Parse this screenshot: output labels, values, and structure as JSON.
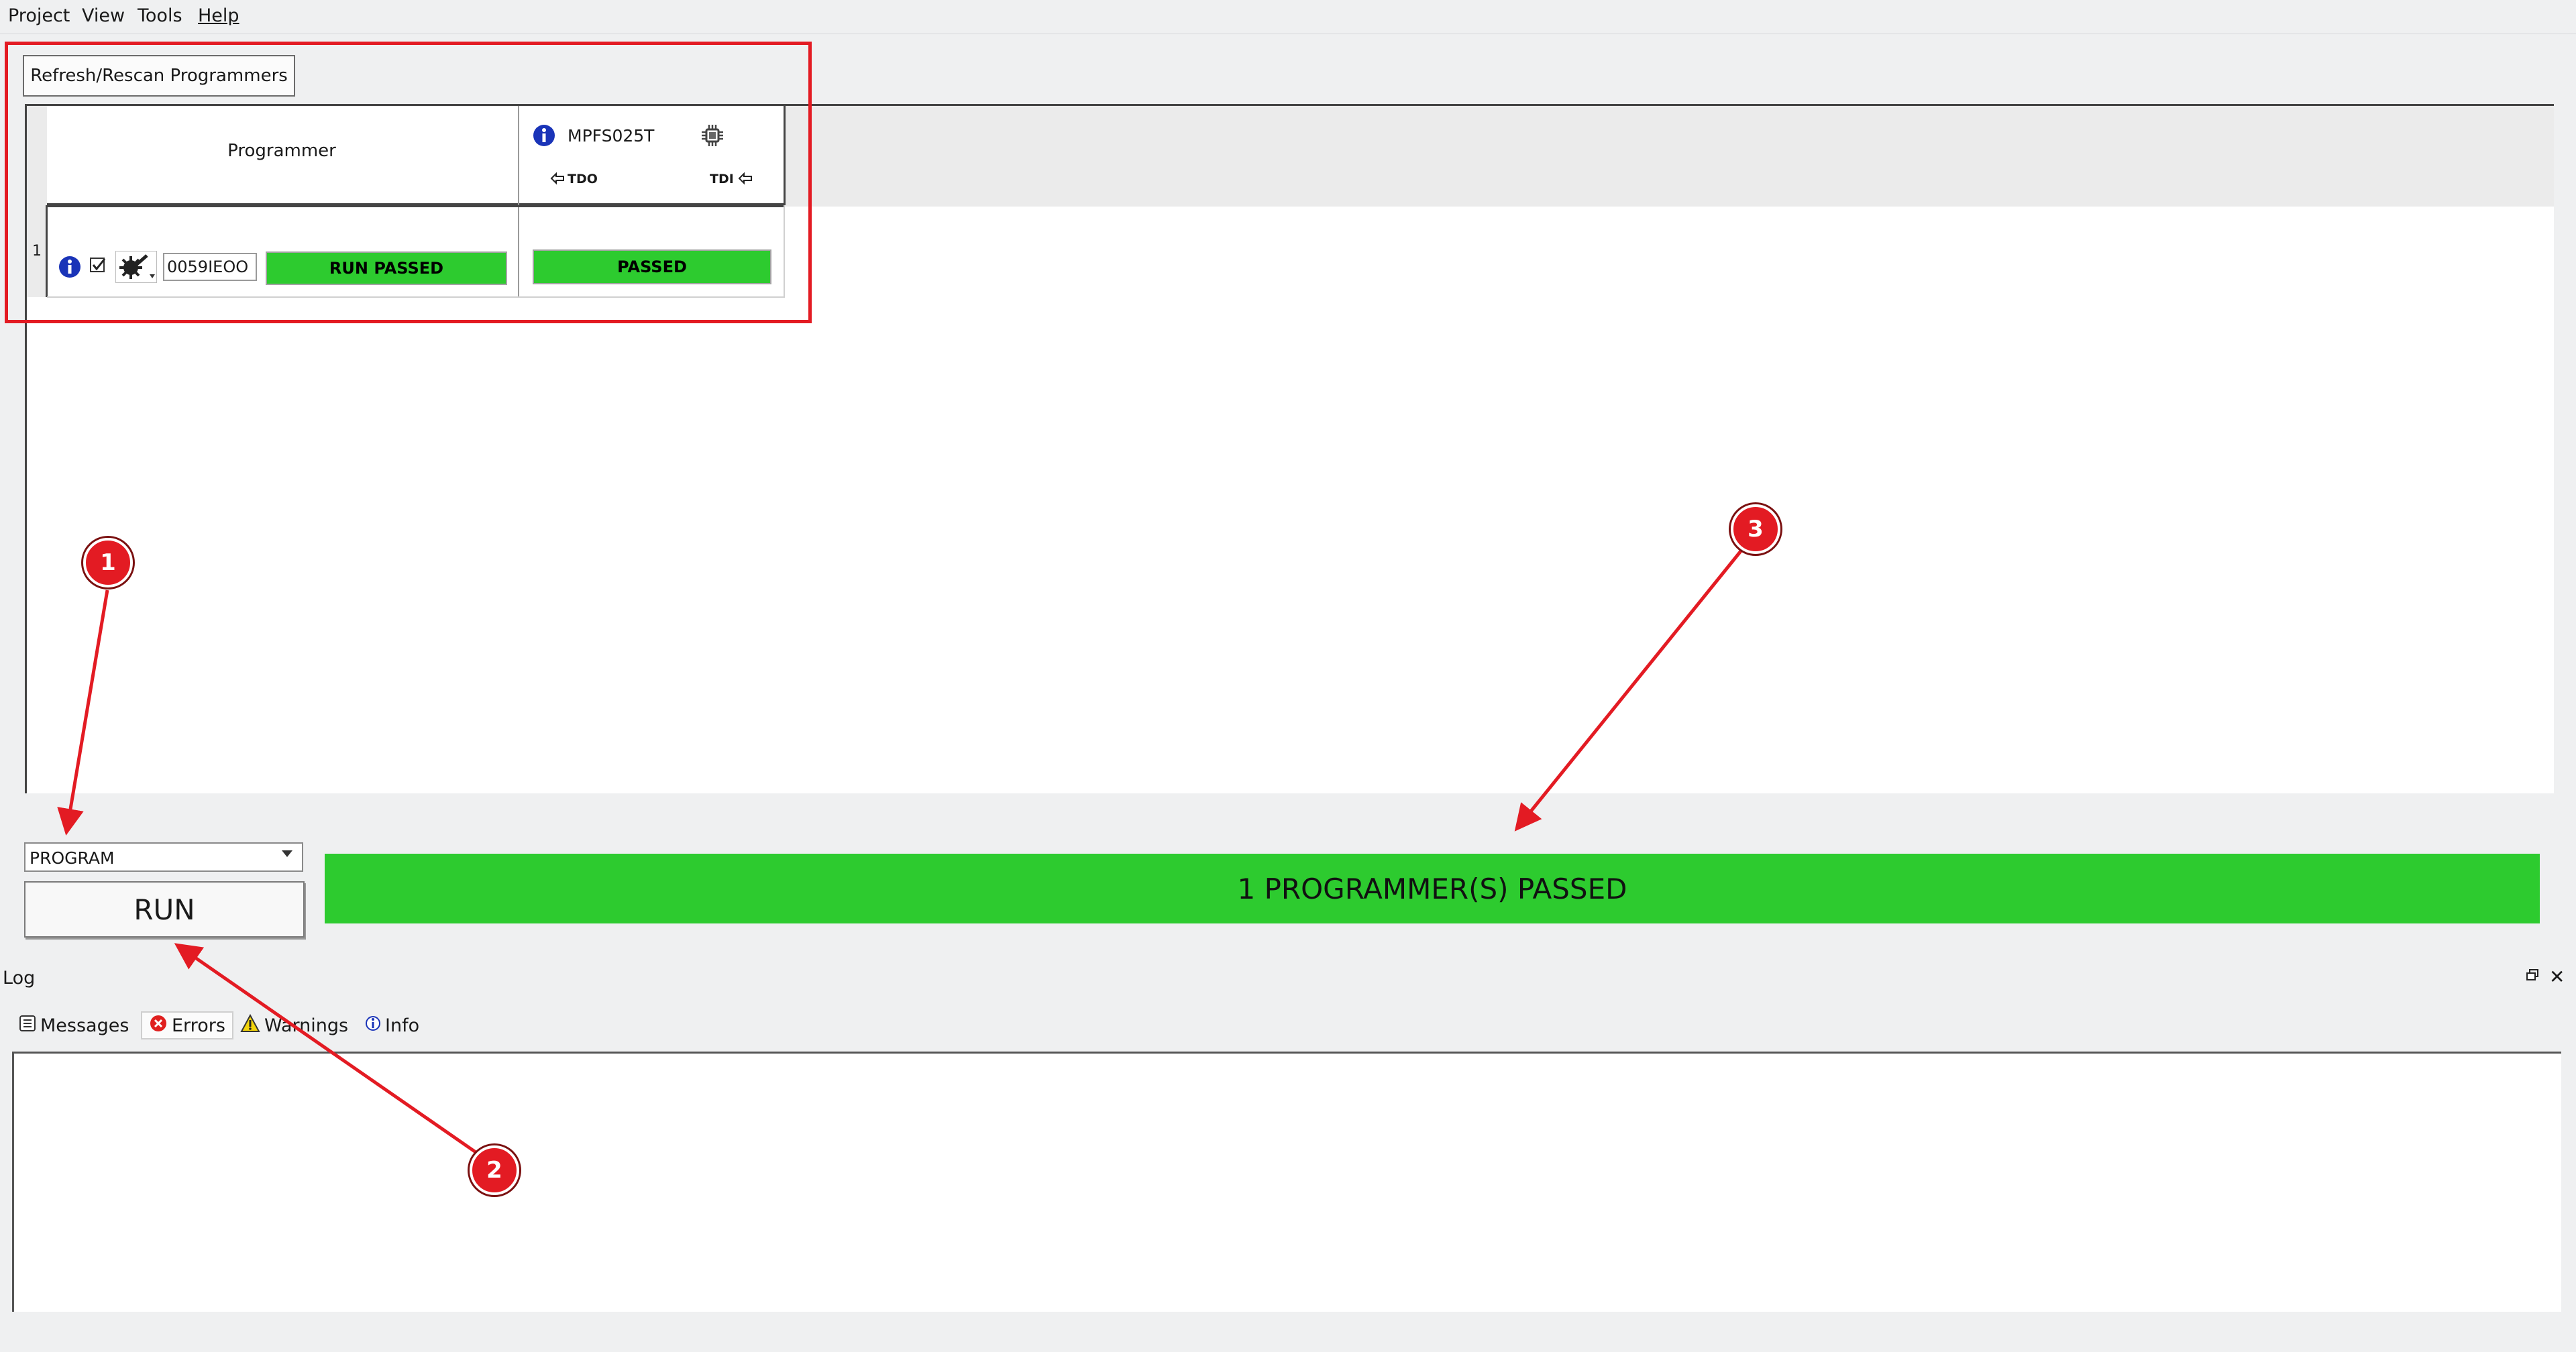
{
  "menu": [
    "Project",
    "View",
    "Tools",
    "Help"
  ],
  "toolbar": {
    "refresh_label": "Refresh/Rescan Programmers"
  },
  "grid": {
    "programmer_header": "Programmer",
    "device_name": "MPFS025T",
    "tdo_label": "TDO",
    "tdi_label": "TDI",
    "rows": [
      {
        "number": "1",
        "serial": "0059IEOO",
        "programmer_status": "RUN PASSED",
        "device_status": "PASSED"
      }
    ]
  },
  "action": {
    "selected": "PROGRAM",
    "run_label": "RUN"
  },
  "status": {
    "text": "1 PROGRAMMER(S) PASSED"
  },
  "log": {
    "title": "Log",
    "tabs": [
      "Messages",
      "Errors",
      "Warnings",
      "Info"
    ]
  },
  "callouts": [
    "1",
    "2",
    "3"
  ],
  "colors": {
    "pass_green": "#2dcb2f",
    "highlight_red": "#e31b23",
    "info_blue": "#1a34b8"
  },
  "icons": [
    "info-icon",
    "checkbox-icon",
    "programmer-settings-icon",
    "chip-icon",
    "arrow-left-icon",
    "messages-icon",
    "error-icon",
    "warning-icon",
    "info-small-icon"
  ]
}
